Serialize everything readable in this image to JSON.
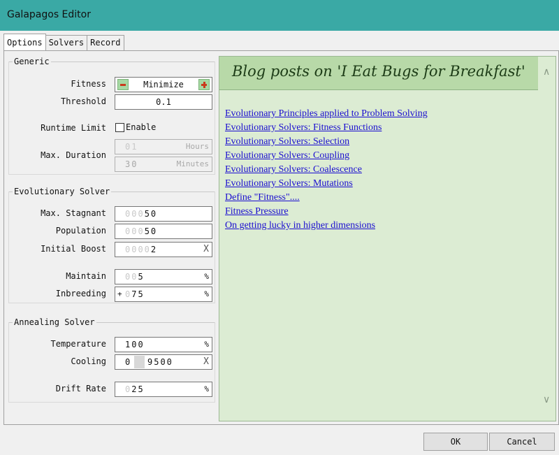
{
  "window": {
    "title": "Galapagos Editor"
  },
  "tabs": [
    {
      "label": "Options",
      "active": true
    },
    {
      "label": "Solvers",
      "active": false
    },
    {
      "label": "Record",
      "active": false
    }
  ],
  "generic": {
    "group_label": "Generic",
    "fitness_label": "Fitness",
    "fitness_value": "Minimize",
    "threshold_label": "Threshold",
    "threshold_value": "0.1",
    "runtime_label": "Runtime Limit",
    "runtime_enable_label": "Enable",
    "runtime_enabled": false,
    "duration_label": "Max. Duration",
    "hours_value": "01",
    "hours_unit": "Hours",
    "minutes_value": "30",
    "minutes_unit": "Minutes"
  },
  "evolutionary": {
    "group_label": "Evolutionary Solver",
    "stagnant_label": "Max. Stagnant",
    "stagnant_prefix": "000",
    "stagnant_value": "50",
    "population_label": "Population",
    "population_prefix": "000",
    "population_value": "50",
    "boost_label": "Initial Boost",
    "boost_prefix": "0000",
    "boost_value": "2",
    "boost_unit": "X",
    "maintain_label": "Maintain",
    "maintain_prefix": "00",
    "maintain_value": "5",
    "maintain_unit": "%",
    "inbreeding_label": "Inbreeding",
    "inbreeding_sign": "+",
    "inbreeding_prefix": "0",
    "inbreeding_value": "75",
    "inbreeding_unit": "%"
  },
  "annealing": {
    "group_label": "Annealing Solver",
    "temperature_label": "Temperature",
    "temperature_value": "100",
    "temperature_unit": "%",
    "cooling_label": "Cooling",
    "cooling_int": "0",
    "cooling_frac": "9500",
    "cooling_unit": "X",
    "drift_label": "Drift Rate",
    "drift_prefix": "0",
    "drift_value": "25",
    "drift_unit": "%"
  },
  "blog": {
    "title": "Blog posts on 'I Eat Bugs for Breakfast'",
    "links": [
      "Evolutionary Principles applied to Problem Solving",
      "Evolutionary Solvers: Fitness Functions",
      "Evolutionary Solvers: Selection",
      "Evolutionary Solvers: Coupling",
      "Evolutionary Solvers: Coalescence",
      "Evolutionary Solvers: Mutations",
      "Define \"Fitness\"....",
      "Fitness Pressure",
      "On getting lucky in higher dimensions"
    ]
  },
  "buttons": {
    "ok": "OK",
    "cancel": "Cancel"
  },
  "colors": {
    "titlebar": "#3aa9a5",
    "blog_bg": "#dcecd3",
    "blog_header": "#b8d9a8",
    "link": "#1a0dd0"
  }
}
